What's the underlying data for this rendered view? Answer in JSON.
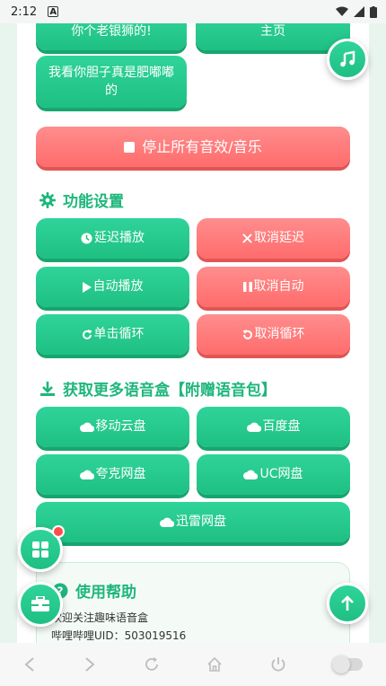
{
  "status_bar": {
    "time": "2:12"
  },
  "top_buttons": [
    {
      "label": "你个老银狮的!"
    },
    {
      "label": "主页"
    },
    {
      "label": "我看你胆子真是肥嘟嘟的"
    }
  ],
  "stop_all": {
    "label": "停止所有音效/音乐"
  },
  "settings": {
    "title": "功能设置",
    "buttons": [
      {
        "label": "延迟播放",
        "icon": "clock-icon"
      },
      {
        "label": "取消延迟",
        "icon": "x-icon"
      },
      {
        "label": "自动播放",
        "icon": "play-icon"
      },
      {
        "label": "取消自动",
        "icon": "pause-icon"
      },
      {
        "label": "单击循环",
        "icon": "redo-icon"
      },
      {
        "label": "取消循环",
        "icon": "undo-icon"
      }
    ]
  },
  "downloads": {
    "title": "获取更多语音盒【附赠语音包】",
    "buttons": [
      {
        "label": "移动云盘",
        "icon": "cloud-icon"
      },
      {
        "label": "百度盘",
        "icon": "cloud-icon"
      },
      {
        "label": "夸克网盘",
        "icon": "cloud-icon"
      },
      {
        "label": "UC网盘",
        "icon": "cloud-icon"
      },
      {
        "label": "迅雷网盘",
        "icon": "cloud-icon"
      }
    ]
  },
  "help": {
    "title": "使用帮助",
    "line1": "欢迎关注趣味语音盒",
    "line2": "哔哩哔哩UID：503019516"
  },
  "colors": {
    "green": "#1fbf83",
    "red": "#ff6c6c",
    "title_green": "#1eb67c"
  }
}
